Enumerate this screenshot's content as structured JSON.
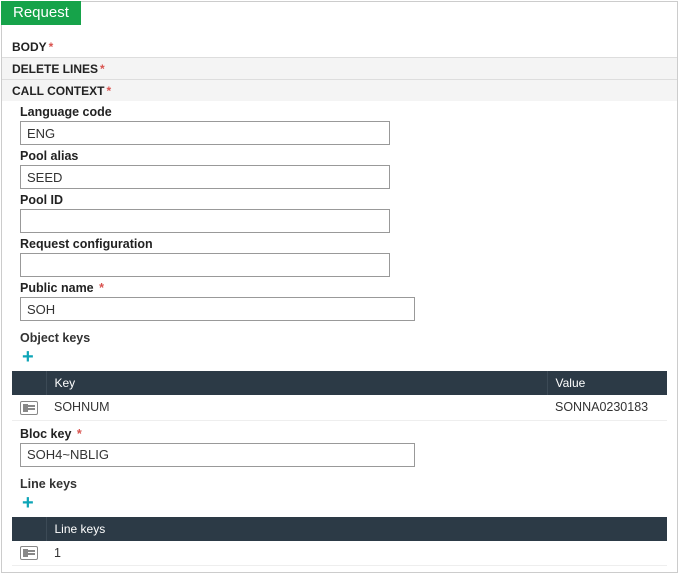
{
  "tab": {
    "label": "Request"
  },
  "sections": {
    "body": "BODY",
    "delete_lines": "DELETE LINES",
    "call_context": "CALL CONTEXT"
  },
  "fields": {
    "language_code": {
      "label": "Language code",
      "value": "ENG"
    },
    "pool_alias": {
      "label": "Pool alias",
      "value": "SEED"
    },
    "pool_id": {
      "label": "Pool ID",
      "value": ""
    },
    "request_configuration": {
      "label": "Request configuration",
      "value": ""
    },
    "public_name": {
      "label": "Public name",
      "value": "SOH"
    },
    "bloc_key": {
      "label": "Bloc key",
      "value": "SOH4~NBLIG"
    }
  },
  "object_keys": {
    "header": "Object keys",
    "columns": {
      "key": "Key",
      "value": "Value"
    },
    "rows": [
      {
        "key": "SOHNUM",
        "value": "SONNA0230183"
      }
    ]
  },
  "line_keys": {
    "header": "Line keys",
    "columns": {
      "col": "Line keys"
    },
    "rows": [
      {
        "val": "1"
      }
    ]
  }
}
